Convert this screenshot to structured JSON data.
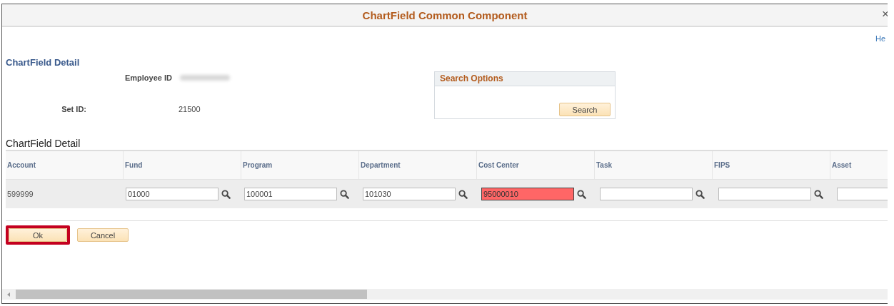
{
  "window": {
    "title": "ChartField Common Component",
    "close": "×"
  },
  "help_link": "He",
  "page_title": "ChartField Detail",
  "employee_id": {
    "label": "Employee ID"
  },
  "set_id": {
    "label": "Set ID:",
    "value": "21500"
  },
  "search_options": {
    "title": "Search Options",
    "button": "Search"
  },
  "grid": {
    "title": "ChartField Detail",
    "columns": [
      "Account",
      "Fund",
      "Program",
      "Department",
      "Cost Center",
      "Task",
      "FIPS",
      "Asset"
    ],
    "rows": [
      {
        "account": "599999",
        "fields": [
          {
            "value": "01000",
            "error": false,
            "lookup": true
          },
          {
            "value": "100001",
            "error": false,
            "lookup": true
          },
          {
            "value": "101030",
            "error": false,
            "lookup": true
          },
          {
            "value": "95000010",
            "error": true,
            "lookup": true
          },
          {
            "error": false,
            "lookup": true
          },
          {
            "error": false,
            "lookup": true
          },
          {
            "error": false
          }
        ]
      }
    ]
  },
  "buttons": [
    {
      "label": "Ok",
      "highlighted": true
    },
    {
      "label": "Cancel",
      "highlighted": false
    }
  ]
}
